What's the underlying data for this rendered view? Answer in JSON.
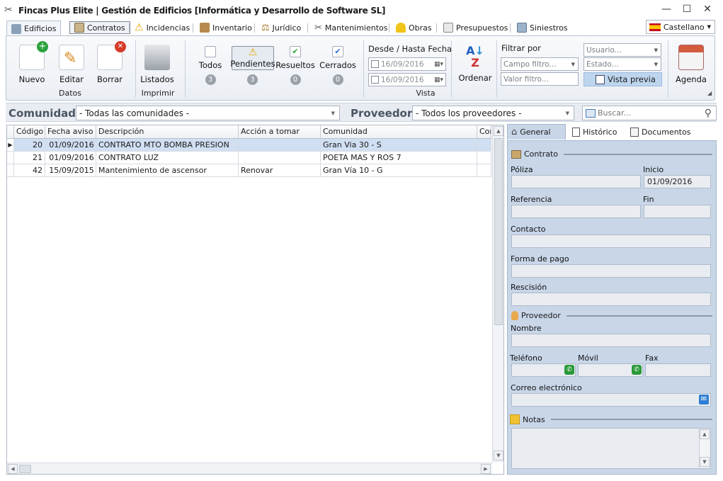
{
  "window": {
    "title": "Fincas Plus Elite | Gestión de Edificios [Informática y Desarrollo de Software SL]",
    "minimize": "—",
    "maximize": "☐",
    "close": "✕"
  },
  "tabs": [
    {
      "label": "Edificios",
      "icon": "building-icon"
    },
    {
      "label": "Contratos",
      "icon": "contract-icon"
    },
    {
      "label": "Incidencias",
      "icon": "warning-icon"
    },
    {
      "label": "Inventario",
      "icon": "box-icon"
    },
    {
      "label": "Jurídico",
      "icon": "scales-icon"
    },
    {
      "label": "Mantenimientos",
      "icon": "tools-icon"
    },
    {
      "label": "Obras",
      "icon": "helmet-icon"
    },
    {
      "label": "Presupuestos",
      "icon": "document-icon"
    },
    {
      "label": "Siniestros",
      "icon": "claim-icon"
    }
  ],
  "language": {
    "label": "Castellano",
    "icon": "spain-flag-icon"
  },
  "ribbon": {
    "datos": {
      "nuevo": "Nuevo",
      "editar": "Editar",
      "borrar": "Borrar",
      "group": "Datos"
    },
    "imprimir": {
      "listados": "Listados",
      "group": "Imprimir"
    },
    "vista": {
      "todos": "Todos",
      "todos_count": "3",
      "pendientes": "Pendientes",
      "pendientes_count": "3",
      "resueltos": "Resueltos",
      "resueltos_count": "0",
      "cerrados": "Cerrados",
      "cerrados_count": "0",
      "date_header": "Desde / Hasta Fecha",
      "date_from": "16/09/2016",
      "date_to": "16/09/2016",
      "ordenar": "Ordenar",
      "group": "Vista"
    },
    "filtrar": {
      "title": "Filtrar por",
      "campo_placeholder": "Campo filtro...",
      "valor_placeholder": "Valor filtro...",
      "usuario": "Usuario...",
      "estado": "Estado...",
      "vista_previa": "Vista previa"
    },
    "agenda": "Agenda"
  },
  "filterbar": {
    "comunidad_label": "Comunidad",
    "comunidad_value": "- Todas las comunidades -",
    "proveedor_label": "Proveedor",
    "proveedor_value": "- Todos los proveedores -",
    "search_placeholder": "Buscar..."
  },
  "grid": {
    "columns": [
      "Código",
      "Fecha aviso",
      "Descripción",
      "Acción a tomar",
      "Comunidad",
      "Con"
    ],
    "rows": [
      {
        "codigo": "20",
        "fecha": "01/09/2016",
        "descripcion": "CONTRATO MTO BOMBA PRESION",
        "accion": "",
        "comunidad": "Gran Via 30 - S"
      },
      {
        "codigo": "21",
        "fecha": "01/09/2016",
        "descripcion": "CONTRATO LUZ",
        "accion": "",
        "comunidad": "POETA MAS Y ROS 7"
      },
      {
        "codigo": "42",
        "fecha": "15/09/2015",
        "descripcion": "Mantenimiento de ascensor",
        "accion": "Renovar",
        "comunidad": "Gran Vía 10 - G"
      }
    ]
  },
  "panel": {
    "tabs": [
      "General",
      "Histórico",
      "Documentos"
    ],
    "contrato": "Contrato",
    "poliza": "Póliza",
    "inicio": "Inicio",
    "inicio_value": "01/09/2016",
    "referencia": "Referencia",
    "fin": "Fin",
    "contacto": "Contacto",
    "forma_pago": "Forma de pago",
    "rescision": "Rescisión",
    "proveedor": "Proveedor",
    "nombre": "Nombre",
    "telefono": "Teléfono",
    "movil": "Móvil",
    "fax": "Fax",
    "correo": "Correo electrónico",
    "notas": "Notas"
  }
}
